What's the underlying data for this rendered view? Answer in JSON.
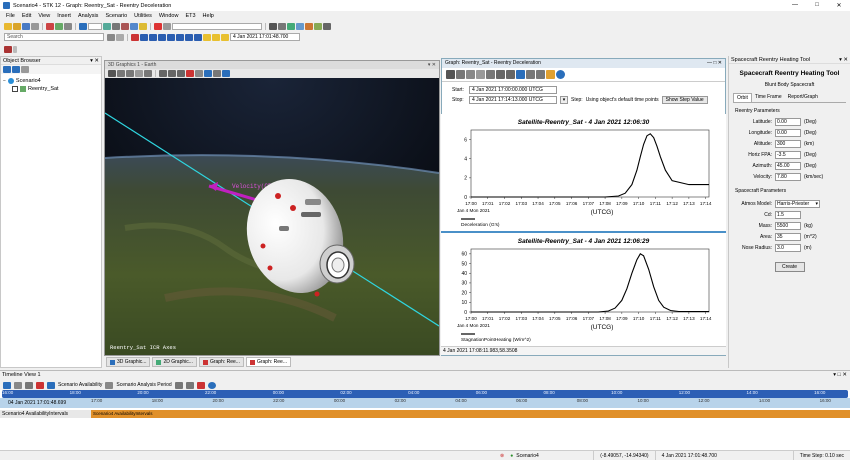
{
  "titlebar": {
    "title": "Scenario4 - STK 12 - Graph: Reentry_Sat - Reentry Deceleration",
    "min": "—",
    "max": "□",
    "close": "✕"
  },
  "menu": [
    "File",
    "Edit",
    "View",
    "Insert",
    "Analysis",
    "Scenario",
    "Utilities",
    "Window",
    "ET3",
    "Help"
  ],
  "toolbar": {
    "search_placeholder": "Search",
    "time_value": "4 Jan 2021 17:01:48.700"
  },
  "object_browser": {
    "title": "Object Browser",
    "items": [
      "Scenario4",
      "Reentry_Sat"
    ]
  },
  "window3d": {
    "title": "3D Graphics 1 - Earth",
    "velocity_label": "Velocity(CBF)",
    "axes_label": "Reentry_Sat ICR Axes"
  },
  "tabs3d": [
    "3D Graphic...",
    "2D Graphic...",
    "Graph: Ree...",
    "Graph: Ree..."
  ],
  "graph": {
    "title": "Graph: Reentry_Sat - Reentry Deceleration",
    "start_label": "Start:",
    "start_value": "4 Jan 2021 17:00:00.000 UTCG",
    "stop_label": "Stop:",
    "stop_value": "4 Jan 2021 17:14:13.000 UTCG",
    "step_label": "Step:",
    "step_text": "Using object's default time points",
    "show_step_button": "Show Step Value",
    "status": "4 Jan 2021 17:08:11.983,58.3508"
  },
  "chart_data": [
    {
      "type": "line",
      "title": "Satellite-Reentry_Sat -  4 Jan 2021 12:06:30",
      "xlabel": "(UTCG)",
      "x_tick_labels": [
        "17:00",
        "17:01",
        "17:02",
        "17:03",
        "17:04",
        "17:05",
        "17:06",
        "17:07",
        "17:08",
        "17:09",
        "17:10",
        "17:11",
        "17:12",
        "17:13",
        "17:14"
      ],
      "x_date_label": [
        "Jan 4 Mon 2021"
      ],
      "ylim": [
        0,
        7
      ],
      "y_ticks": [
        0,
        2,
        4,
        6
      ],
      "series": [
        {
          "name": "Deceleration (G's)",
          "x_minutes": [
            0,
            8.0,
            8.8,
            9.2,
            9.6,
            9.9,
            10.1,
            10.3,
            10.5,
            10.7,
            10.9,
            11.1,
            11.3,
            11.6,
            12.0,
            13.0,
            14.2
          ],
          "values": [
            0,
            0,
            0.1,
            0.4,
            1.3,
            2.8,
            4.2,
            5.5,
            6.4,
            6.6,
            6.2,
            5.3,
            4.2,
            2.8,
            1.7,
            1.3,
            1.3
          ]
        }
      ]
    },
    {
      "type": "line",
      "title": "Satellite-Reentry_Sat -  4 Jan 2021 12:06:29",
      "xlabel": "(UTCG)",
      "x_tick_labels": [
        "17:00",
        "17:01",
        "17:02",
        "17:03",
        "17:04",
        "17:05",
        "17:06",
        "17:07",
        "17:08",
        "17:09",
        "17:10",
        "17:11",
        "17:12",
        "17:13",
        "17:14"
      ],
      "x_date_label": [
        "Jan 4 Mon 2021"
      ],
      "ylim": [
        0,
        65
      ],
      "y_ticks": [
        0,
        10,
        20,
        30,
        40,
        50,
        60
      ],
      "series": [
        {
          "name": "StagnationPointHeating (W/m^2)",
          "x_minutes": [
            0,
            7.6,
            8.2,
            8.6,
            9.0,
            9.3,
            9.6,
            9.9,
            10.1,
            10.3,
            10.6,
            10.9,
            11.2,
            11.5,
            11.9,
            12.4,
            14.2
          ],
          "values": [
            0,
            0,
            1,
            4,
            12,
            24,
            40,
            54,
            60,
            58,
            44,
            26,
            12,
            5,
            1.5,
            0.5,
            0.5
          ]
        }
      ]
    }
  ],
  "tool": {
    "title": "Spacecraft Reentry Heating Tool",
    "header": "Spacecraft Reentry Heating Tool",
    "subtitle": "Blunt Body Spacecraft",
    "tabs": [
      "Orbit",
      "Time Frame",
      "Report/Graph"
    ],
    "reentry_group": "Reentry Parameters",
    "reentry": [
      {
        "label": "Latitude:",
        "value": "0.00",
        "unit": "(Deg)"
      },
      {
        "label": "Longitude:",
        "value": "0.00",
        "unit": "(Deg)"
      },
      {
        "label": "Altitude:",
        "value": "300",
        "unit": "(km)"
      },
      {
        "label": "Horiz FPA:",
        "value": "-3.5",
        "unit": "(Deg)"
      },
      {
        "label": "Azimuth:",
        "value": "45.00",
        "unit": "(Deg)"
      },
      {
        "label": "Velocity:",
        "value": "7.80",
        "unit": "(km/sec)"
      }
    ],
    "spacecraft_group": "Spacecraft Parameters",
    "atmos_label": "Atmos Model:",
    "atmos_value": "Harris-Priester",
    "spacecraft": [
      {
        "label": "Cd:",
        "value": "1.5",
        "unit": ""
      },
      {
        "label": "Mass:",
        "value": "5500",
        "unit": "(kg)"
      },
      {
        "label": "Area:",
        "value": "35",
        "unit": "(m^2)"
      },
      {
        "label": "Nose Radius:",
        "value": "3.0",
        "unit": "(m)"
      }
    ],
    "create_button": "Create"
  },
  "timeline": {
    "title": "Timeline View 1",
    "availability_label": "Scenario Availability",
    "analysis_label": "Scenario Analysis Period",
    "current_time": "04 Jan 2021 17:01:48.699",
    "top_ticks": [
      "16:00",
      "18:00",
      "20:00",
      "22:00",
      "00:00",
      "02:00",
      "04:00",
      "06:00",
      "08:00",
      "10:00",
      "12:00",
      "14:00",
      "16:00"
    ],
    "lower_ticks": [
      "17:00",
      "18:00",
      "20:00",
      "22:00",
      "00:00",
      "02:00",
      "04:00",
      "06:00",
      "08:00",
      "10:00",
      "12:00",
      "14:00",
      "16:00"
    ],
    "row_label": "Scenario4 AvailabilityIntervals",
    "bar_label": "Scenario4 AvailabilityIntervals"
  },
  "statusbar": {
    "scenario": "Scenario4",
    "coords": "(-8.49057, -14.94340)",
    "time": "4 Jan 2021 17:01:48.700",
    "step": "Time Step: 0.10 sec"
  }
}
